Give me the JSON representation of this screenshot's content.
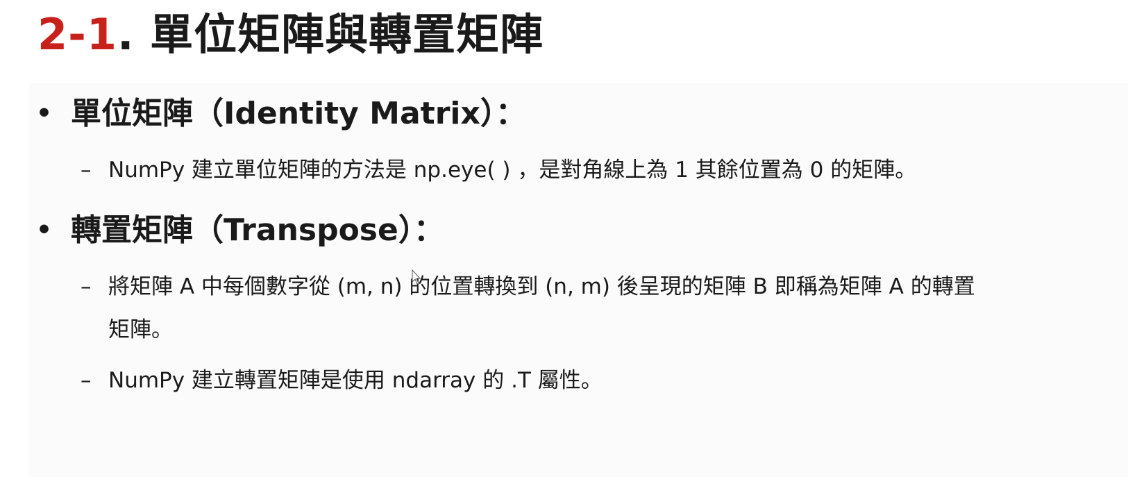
{
  "title": {
    "number": "2-1",
    "text": ". 單位矩陣與轉置矩陣"
  },
  "sections": [
    {
      "heading": "單位矩陣（Identity Matrix）：",
      "items": [
        "NumPy 建立單位矩陣的方法是 np.eye( ) ，是對角線上為 1 其餘位置為 0 的矩陣。"
      ]
    },
    {
      "heading": "轉置矩陣（Transpose）：",
      "items": [
        "將矩陣 A 中每個數字從 (m, n) 的位置轉換到 (n, m) 後呈現的矩陣 B 即稱為矩陣 A 的轉置",
        "NumPy 建立轉置矩陣是使用 ndarray 的 .T 屬性。"
      ],
      "continuation": "矩陣。"
    }
  ],
  "colors": {
    "accent": "#c8201a",
    "text": "#1a1a1a"
  },
  "bullet_glyph": "•",
  "dash_glyph": "–"
}
